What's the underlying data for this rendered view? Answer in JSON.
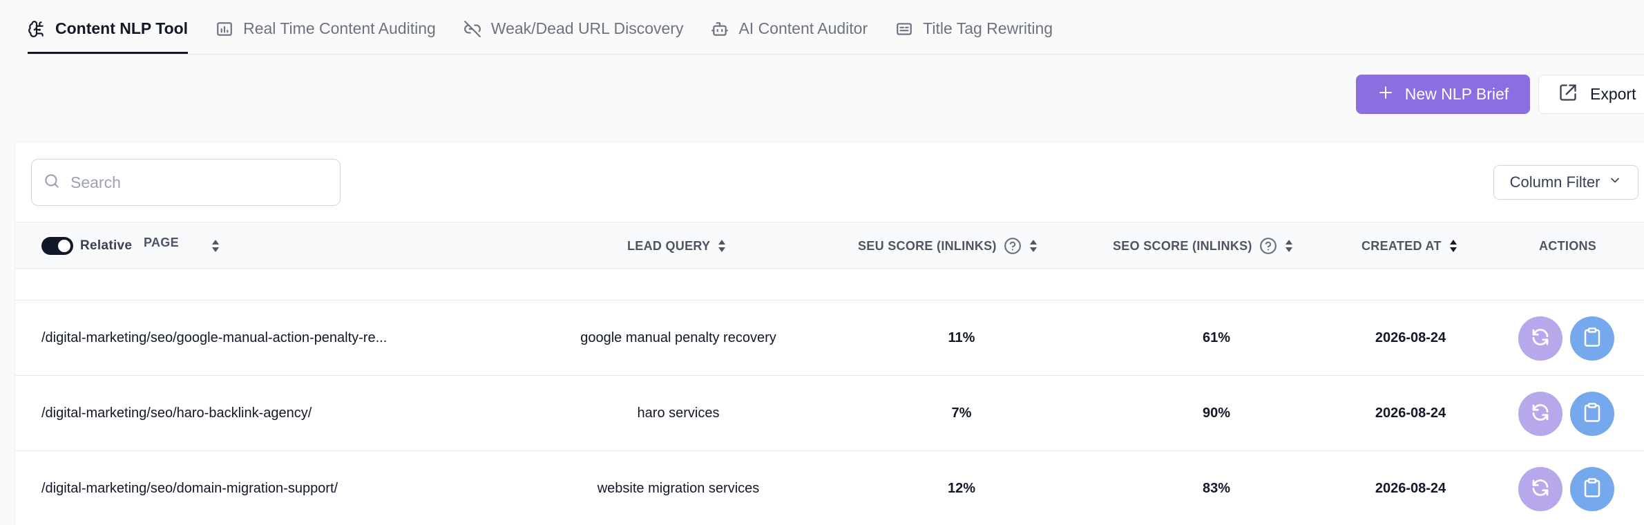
{
  "tabs": [
    {
      "label": "Content NLP Tool",
      "icon": "brain-icon",
      "active": true
    },
    {
      "label": "Real Time Content Auditing",
      "icon": "chart-icon",
      "active": false
    },
    {
      "label": "Weak/Dead URL Discovery",
      "icon": "broken-link-icon",
      "active": false
    },
    {
      "label": "AI Content Auditor",
      "icon": "robot-icon",
      "active": false
    },
    {
      "label": "Title Tag Rewriting",
      "icon": "title-card-icon",
      "active": false
    }
  ],
  "toolbar": {
    "new_label": "New NLP Brief",
    "export_label": "Export"
  },
  "search": {
    "placeholder": "Search",
    "value": ""
  },
  "column_filter": {
    "label": "Column Filter"
  },
  "table": {
    "relative_label": "Relative",
    "relative_on": true,
    "headers": {
      "page": "PAGE",
      "lead_query": "LEAD QUERY",
      "seu_score": "SEU SCORE (INLINKS)",
      "seo_score": "SEO SCORE (INLINKS)",
      "created_at": "CREATED AT",
      "actions": "ACTIONS"
    },
    "rows": [
      {
        "page": "/digital-marketing/seo/google-manual-action-penalty-re...",
        "lead_query": "google manual penalty recovery",
        "seu": "11%",
        "seo": "61%",
        "created": "2026-08-24"
      },
      {
        "page": "/digital-marketing/seo/haro-backlink-agency/",
        "lead_query": "haro services",
        "seu": "7%",
        "seo": "90%",
        "created": "2026-08-24"
      },
      {
        "page": "/digital-marketing/seo/domain-migration-support/",
        "lead_query": "website migration services",
        "seu": "12%",
        "seo": "83%",
        "created": "2026-08-24"
      }
    ]
  },
  "colors": {
    "primary": "#8b6fe0",
    "refresh_button": "#b7a8ec",
    "copy_button": "#76a8ee",
    "toggle": "#111827"
  }
}
